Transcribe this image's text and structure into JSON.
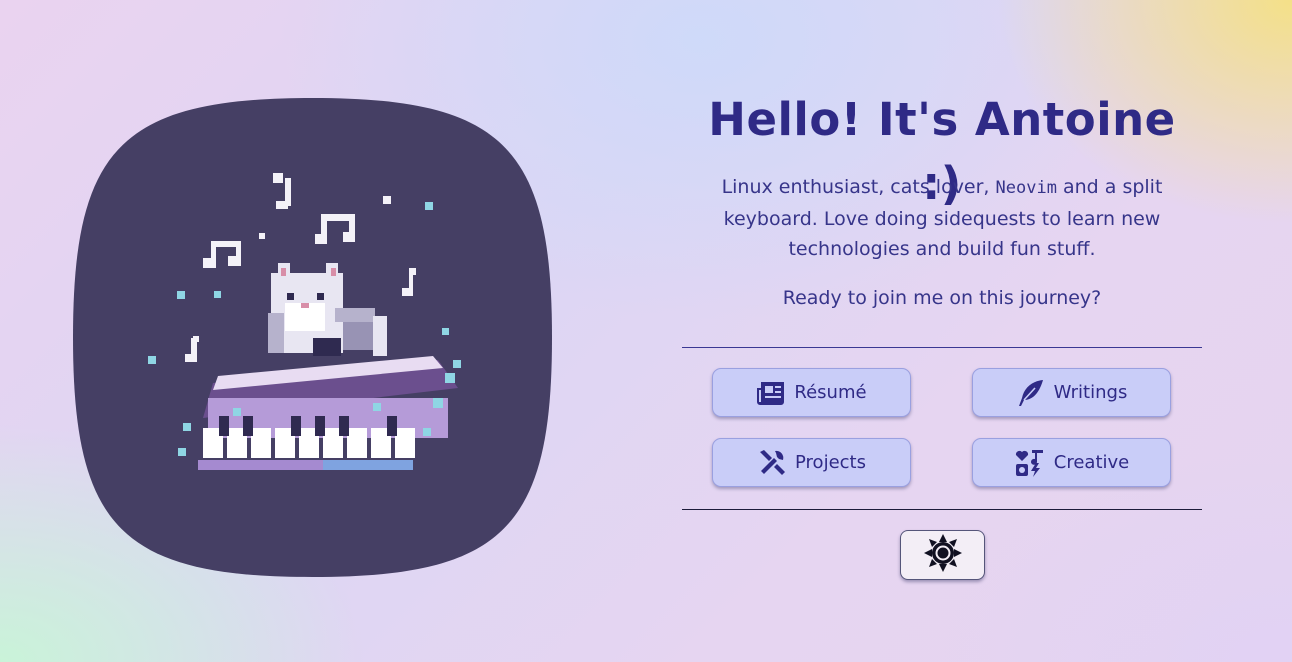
{
  "profile": {
    "greeting": "Hello! It's Antoine :)",
    "bio_before_code": "Linux enthusiast, cats lover, ",
    "bio_code": "Neovim",
    "bio_after_code": " and a split keyboard. Love doing sidequests to learn new technologies and build fun stuff.",
    "call_to_action": "Ready to join me on this journey?",
    "avatar_icon": "pixel-cat-playing-keyboard"
  },
  "nav": {
    "resume": {
      "label": "Résumé",
      "icon": "newspaper-icon"
    },
    "writings": {
      "label": "Writings",
      "icon": "feather-icon"
    },
    "projects": {
      "label": "Projects",
      "icon": "tools-icon"
    },
    "creative": {
      "label": "Creative",
      "icon": "shapes-icon"
    }
  },
  "theme_toggle": {
    "icon": "sun-icon"
  },
  "colors": {
    "accent": "#2f2a86",
    "button_bg": "#c9cdf8",
    "avatar_bg": "#453f64"
  }
}
